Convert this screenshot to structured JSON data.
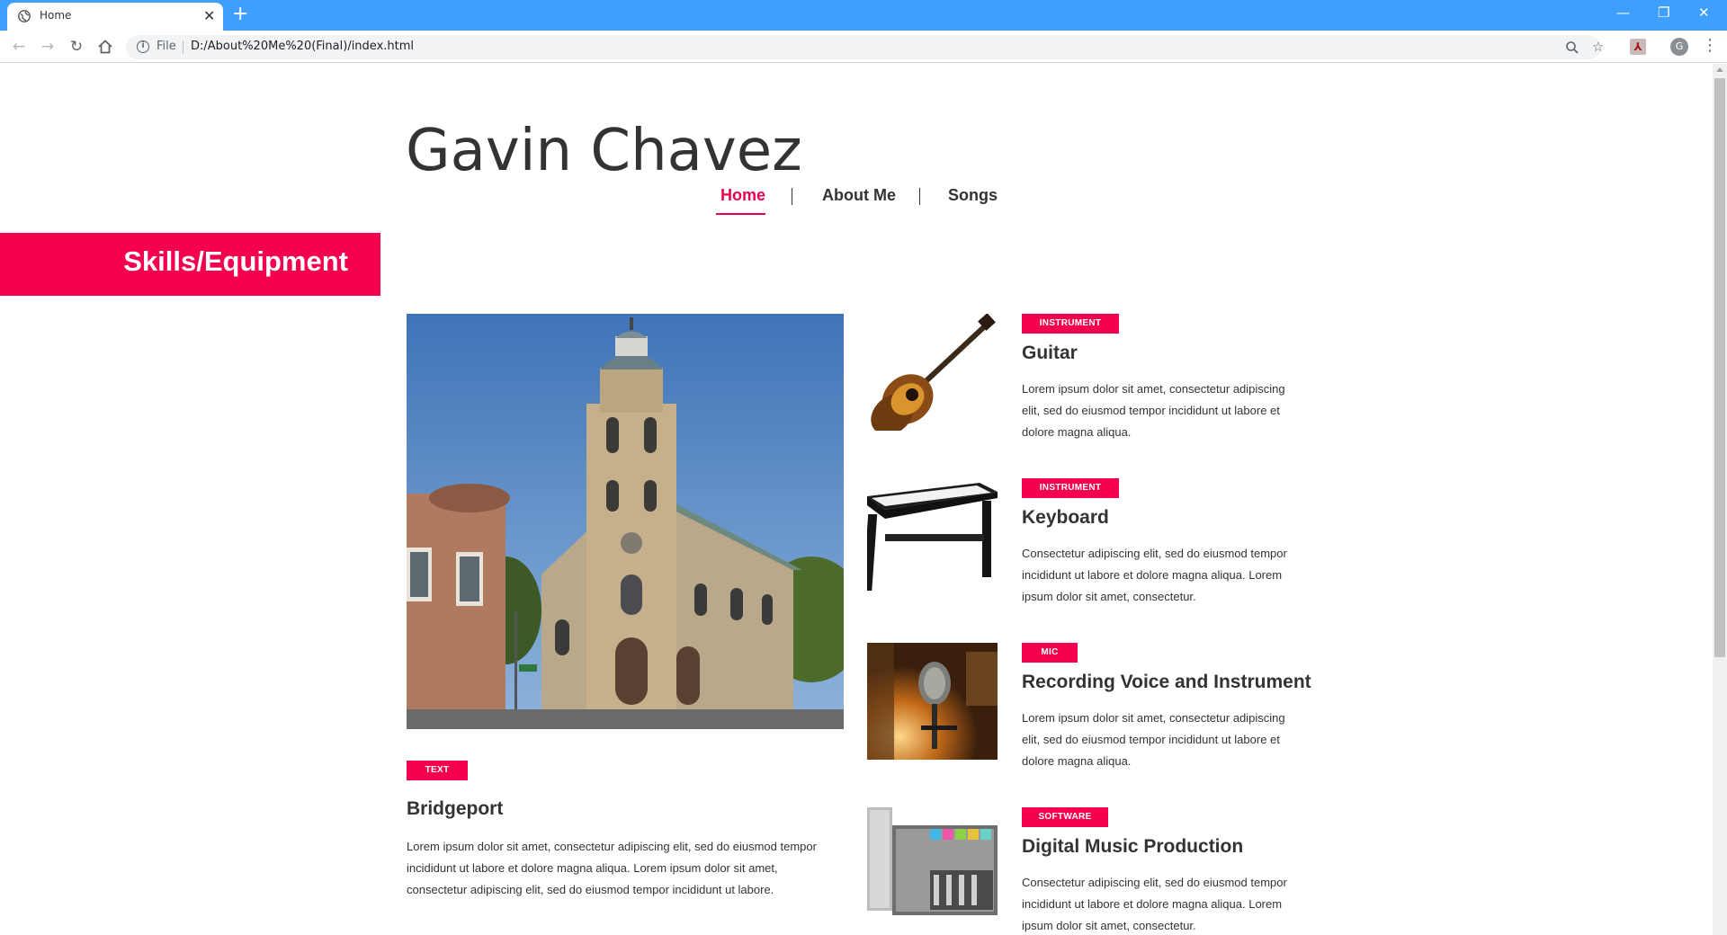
{
  "browser": {
    "tab_title": "Home",
    "new_tab_symbol": "+",
    "file_label": "File",
    "url": "D:/About%20Me%20(Final)/index.html",
    "profile_initial": "G"
  },
  "site": {
    "title": "Gavin Chavez",
    "nav": [
      {
        "label": "Home",
        "active": true
      },
      {
        "label": "About Me",
        "active": false
      },
      {
        "label": "Songs",
        "active": false
      }
    ],
    "section_heading": "Skills/Equipment"
  },
  "feature": {
    "tag": "TEXT",
    "title": "Bridgeport",
    "body": "Lorem ipsum dolor sit amet, consectetur adipiscing elit, sed do eiusmod tempor incididunt ut labore et dolore magna aliqua. Lorem ipsum dolor sit amet, consectetur adipiscing elit, sed do eiusmod tempor incididunt ut labore.",
    "image": "church-building-photo"
  },
  "cards": [
    {
      "tag": "INSTRUMENT",
      "title": "Guitar",
      "body": "Lorem ipsum dolor sit amet, consectetur adipiscing elit, sed do eiusmod tempor incididunt ut labore et dolore magna aliqua.",
      "image": "acoustic-guitar-photo"
    },
    {
      "tag": "INSTRUMENT",
      "title": "Keyboard",
      "body": "Consectetur adipiscing elit, sed do eiusmod tempor incididunt ut labore et dolore magna aliqua. Lorem ipsum dolor sit amet, consectetur.",
      "image": "keyboard-photo"
    },
    {
      "tag": "MIC",
      "title": "Recording Voice and Instrument",
      "body": "Lorem ipsum dolor sit amet, consectetur adipiscing elit, sed do eiusmod tempor incididunt ut labore et dolore magna aliqua.",
      "image": "studio-microphone-photo"
    },
    {
      "tag": "SOFTWARE",
      "title": "Digital Music Production",
      "body": "Consectetur adipiscing elit, sed do eiusmod tempor incididunt ut labore et dolore magna aliqua. Lorem ipsum dolor sit amet, consectetur.",
      "image": "daw-software-box-photo"
    }
  ],
  "colors": {
    "accent": "#f5004f",
    "text": "#333333",
    "chrome_blue": "#3f9fff"
  }
}
